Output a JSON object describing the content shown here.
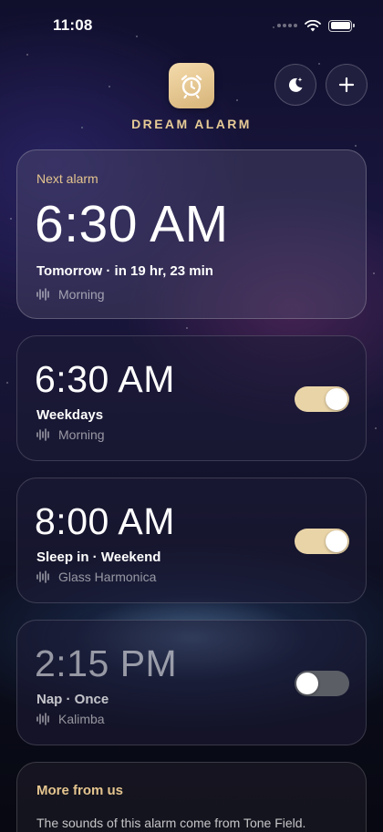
{
  "status": {
    "time": "11:08"
  },
  "header": {
    "app_title": "DREAM ALARM",
    "icons": {
      "app": "alarm-clock-icon",
      "bedtime": "moon-stars-icon",
      "add": "plus-icon"
    }
  },
  "next_alarm": {
    "label": "Next alarm",
    "time": "6:30 AM",
    "when": "Tomorrow · in 19 hr, 23 min",
    "sound": "Morning"
  },
  "alarms": [
    {
      "time": "6:30 AM",
      "repeat": "Weekdays",
      "sound": "Morning",
      "enabled": true
    },
    {
      "time": "8:00 AM",
      "repeat": "Sleep in · Weekend",
      "sound": "Glass Harmonica",
      "enabled": true
    },
    {
      "time": "2:15 PM",
      "repeat": "Nap · Once",
      "sound": "Kalimba",
      "enabled": false
    }
  ],
  "more": {
    "title": "More from us",
    "text": "The sounds of this alarm come from Tone Field."
  },
  "colors": {
    "accent": "#e5c58f",
    "toggle_on": "#e9d4a8",
    "toggle_off": "#5c5e66"
  }
}
